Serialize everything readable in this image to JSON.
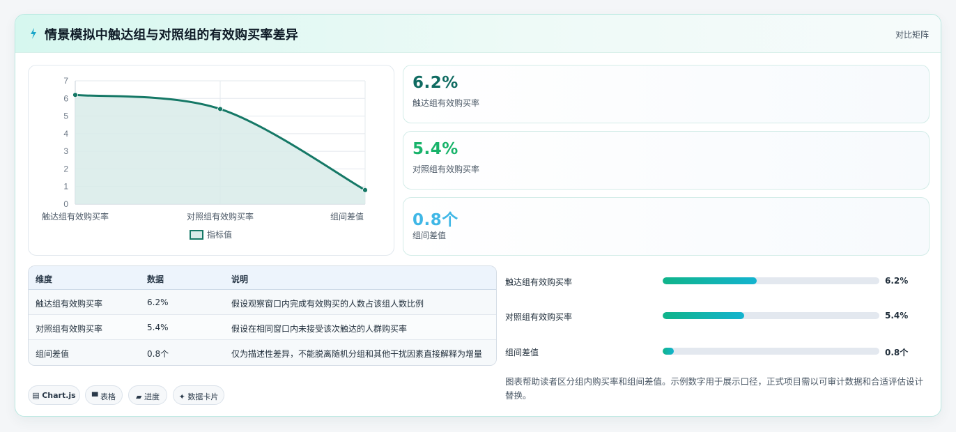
{
  "header": {
    "title": "情景模拟中触达组与对照组的有效购买率差异",
    "tag": "对比矩阵",
    "icon": "lightning-icon"
  },
  "chart_data": {
    "type": "line",
    "categories": [
      "触达组有效购买率",
      "对照组有效购买率",
      "组间差值"
    ],
    "series": [
      {
        "name": "指标值",
        "values": [
          6.2,
          5.4,
          0.8
        ]
      }
    ],
    "ylim": [
      0,
      7
    ],
    "yticks": [
      0,
      1,
      2,
      3,
      4,
      5,
      6,
      7
    ],
    "grid": true,
    "filled": true,
    "legend": "bottom",
    "colors": {
      "line": "#157866",
      "fill": "#d8ebe9"
    }
  },
  "stats": [
    {
      "value": "6.2%",
      "label": "触达组有效购买率",
      "color": "#0f6b61"
    },
    {
      "value": "5.4%",
      "label": "对照组有效购买率",
      "color": "#18b36a"
    },
    {
      "value": "0.8个",
      "label": "组间差值",
      "color": "#3fb7e6"
    }
  ],
  "table": {
    "headers": [
      "维度",
      "数据",
      "说明"
    ],
    "rows": [
      [
        "触达组有效购买率",
        "6.2%",
        "假设观察窗口内完成有效购买的人数占该组人数比例"
      ],
      [
        "对照组有效购买率",
        "5.4%",
        "假设在相同窗口内未接受该次触达的人群购买率"
      ],
      [
        "组间差值",
        "0.8个",
        "仅为描述性差异，不能脱离随机分组和其他干扰因素直接解释为增量"
      ]
    ]
  },
  "bars": [
    {
      "label": "触达组有效购买率",
      "value": "6.2%",
      "fraction": 0.434
    },
    {
      "label": "对照组有效购买率",
      "value": "5.4%",
      "fraction": 0.376
    },
    {
      "label": "组间差值",
      "value": "0.8个",
      "fraction": 0.05
    }
  ],
  "badges": [
    {
      "icon": "chart-icon",
      "label": "Chart.js",
      "glyph": "▤"
    },
    {
      "icon": "table-icon",
      "label": "表格",
      "glyph": "▀"
    },
    {
      "icon": "progress-icon",
      "label": "进度",
      "glyph": "▰"
    },
    {
      "icon": "sparkle-icon",
      "label": "数据卡片",
      "glyph": "✦"
    }
  ],
  "note": "图表帮助读者区分组内购买率和组间差值。示例数字用于展示口径，正式项目需以可审计数据和合适评估设计替换。"
}
